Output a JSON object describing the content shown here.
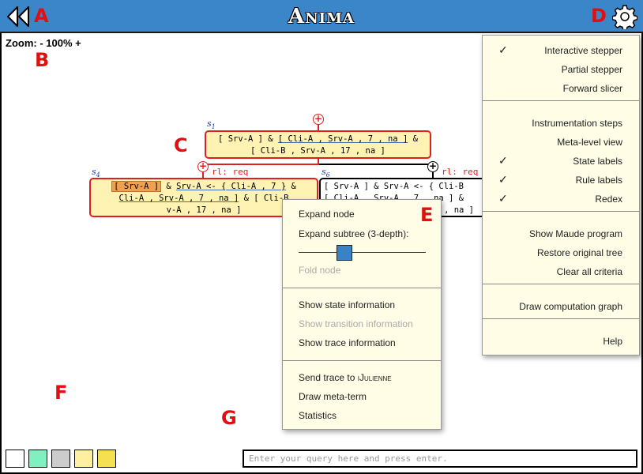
{
  "app": {
    "title": "Anima"
  },
  "labels": {
    "a": "A",
    "b": "B",
    "c": "C",
    "d": "D",
    "e": "E",
    "f": "F",
    "g": "G"
  },
  "zoom": {
    "text": "Zoom: - 100% +"
  },
  "tree": {
    "s1": {
      "label": "s",
      "sub": "1",
      "line1_a": "[ Srv-A ] & ",
      "line1_b": "[ Cli-A , Srv-A , 7 , na ]",
      "line1_c": " &",
      "line2": "[ Cli-B , Srv-A , 17 , na ]"
    },
    "s4": {
      "label": "s",
      "sub": "4",
      "rule": "rl: req",
      "l1_a": "[ Srv-A ]",
      "l1_b": " & ",
      "l1_c": "Srv-A <- { Cli-A , 7 }",
      "l1_d": "  &",
      "l2_a": "Cli-A , Srv-A , 7 , na ]",
      "l2_b": " & [ Cli-B",
      "l3": "v-A , 17 , na ]"
    },
    "s6": {
      "label": "s",
      "sub": "6",
      "rule": "rl: req",
      "l1": "[ Srv-A ] &  Srv-A <- { Cli-B",
      "l2": "[ Cli-A , Srv-A , 7 , na ] &",
      "l3": ", na ]"
    },
    "plus_symbol": "+"
  },
  "context_menu": {
    "expand_node": "Expand node",
    "expand_subtree": "Expand subtree (3-depth):",
    "fold_node": "Fold node",
    "show_state": "Show state information",
    "show_transition": "Show transition information",
    "show_trace": "Show trace information",
    "send_trace_prefix": "Send trace to ",
    "send_trace_target": "iJulienne",
    "draw_meta": "Draw meta-term",
    "statistics": "Statistics",
    "subtree_depth": 0.35
  },
  "settings": {
    "groups": [
      [
        {
          "label": "Interactive stepper",
          "checked": true
        },
        {
          "label": "Partial stepper",
          "checked": false
        },
        {
          "label": "Forward slicer",
          "checked": false
        }
      ],
      [
        {
          "label": "Instrumentation steps",
          "checked": false
        },
        {
          "label": "Meta-level view",
          "checked": false
        },
        {
          "label": "State labels",
          "checked": true
        },
        {
          "label": "Rule labels",
          "checked": true
        },
        {
          "label": "Redex",
          "checked": true
        }
      ],
      [
        {
          "label": "Show Maude program",
          "checked": false
        },
        {
          "label": "Restore original tree",
          "checked": false
        },
        {
          "label": "Clear all criteria",
          "checked": false
        }
      ],
      [
        {
          "label": "Draw computation graph",
          "checked": false
        }
      ],
      [
        {
          "label": "Help",
          "checked": false
        }
      ]
    ],
    "check_mark": "✓"
  },
  "swatches": {
    "colors": [
      "#ffffff",
      "#80f0c0",
      "#cccccc",
      "#fff0a0",
      "#f5e050"
    ]
  },
  "query": {
    "placeholder": "Enter your query here and press enter."
  }
}
